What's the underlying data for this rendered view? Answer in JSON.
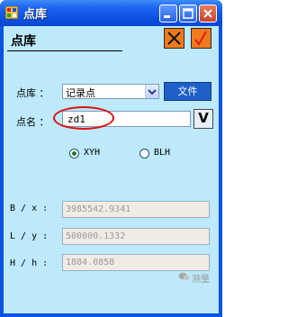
{
  "window": {
    "title": "点库"
  },
  "panel": {
    "title": "点库"
  },
  "form": {
    "library_label": "点库 ：",
    "library_value": "记录点",
    "file_button": "文件",
    "name_label": "点名 ：",
    "name_value": "zd1",
    "v_button": "V"
  },
  "coords": {
    "options": [
      {
        "label": "XYH",
        "selected": true
      },
      {
        "label": "BLH",
        "selected": false
      }
    ]
  },
  "fields": [
    {
      "label": "B / x :",
      "value": "3985542.9341"
    },
    {
      "label": "L / y :",
      "value": "500000.1332"
    },
    {
      "label": "H / h :",
      "value": "1884.0858"
    }
  ],
  "watermark": {
    "text": "测量"
  },
  "colors": {
    "titlebar": "#0a53e4",
    "client": "#bde9fb",
    "accent_button": "#f07a1a",
    "file_button": "#1f5fc8",
    "highlight": "#e01010"
  }
}
